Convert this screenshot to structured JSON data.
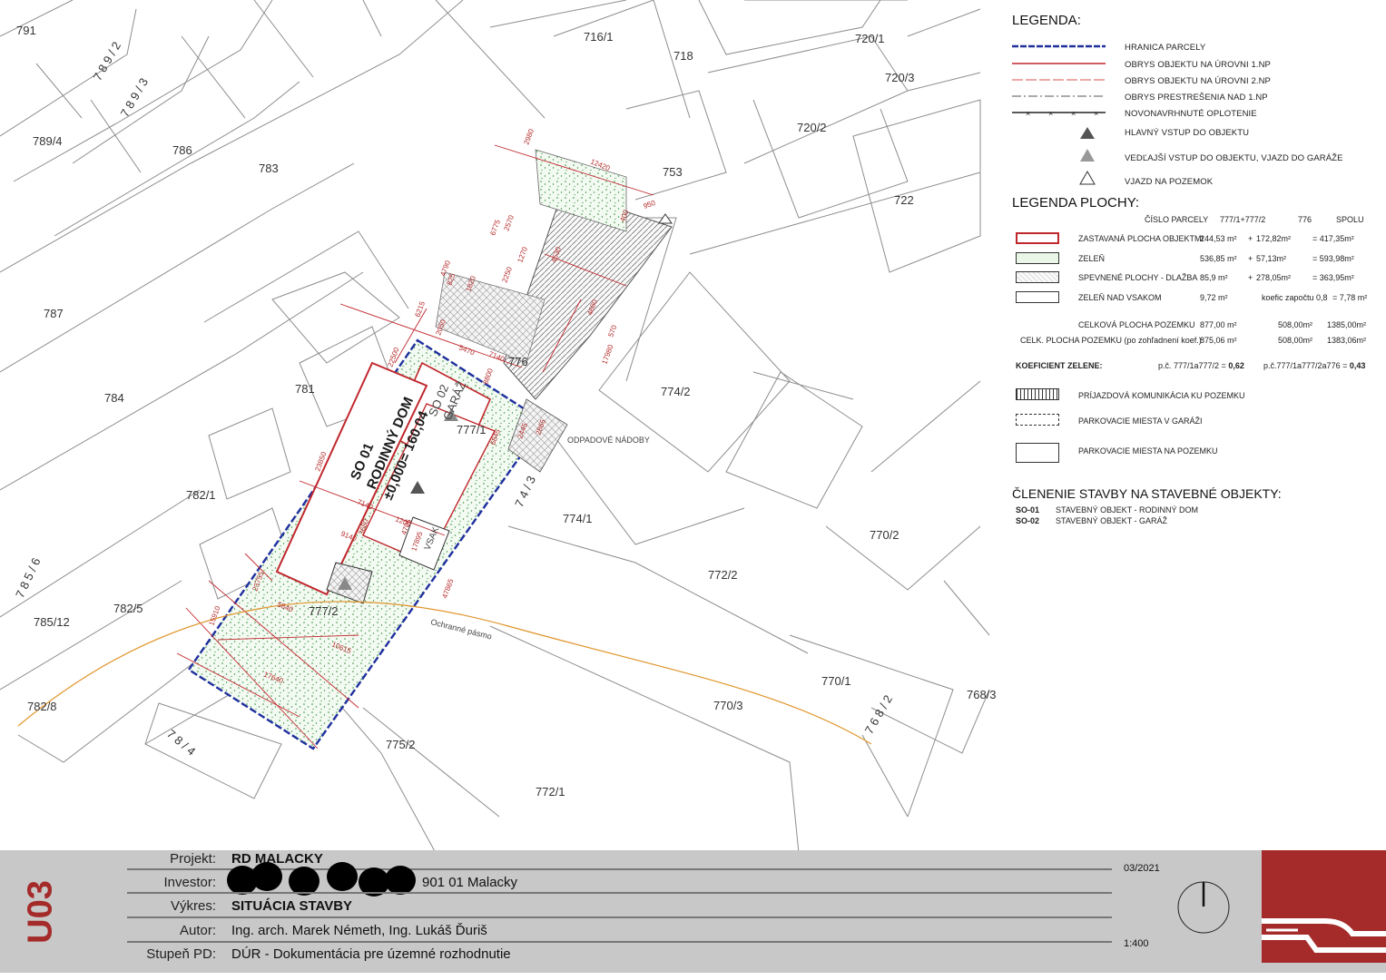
{
  "legend": {
    "title": "LEGENDA:",
    "items": [
      "HRANICA PARCELY",
      "OBRYS OBJEKTU NA ÚROVNI 1.NP",
      "OBRYS OBJEKTU NA ÚROVNI 2.NP",
      "OBRYS PRESTREŠENIA NAD 1.NP",
      "NOVONAVRHNUTÉ OPLOTENIE",
      "HLAVNÝ VSTUP DO OBJEKTU",
      "VEDĽAJŠÍ VSTUP DO OBJEKTU, VJAZD DO GARÁŽE",
      "VJAZD NA POZEMOK"
    ],
    "colors": {
      "parcel_boundary": "#1f2f9e",
      "outline_1np": "#c0272d",
      "outline_2np": "#d9534f",
      "canopy": "#555555",
      "fence": "#222222"
    }
  },
  "area_legend": {
    "title": "LEGENDA PLOCHY:",
    "header": {
      "col_label": "ČÍSLO PARCELY",
      "c1": "777/1+777/2",
      "c2": "776",
      "c3": "SPOLU"
    },
    "rows": [
      {
        "label": "ZASTAVANÁ PLOCHA OBJEKTMI",
        "v1": "244,53 m²",
        "op": "+",
        "v2": "172,82m²",
        "eq": "= 417,35m²"
      },
      {
        "label": "ZELEŇ",
        "v1": "536,85 m²",
        "op": "+",
        "v2": "57,13m²",
        "eq": "= 593,98m²"
      },
      {
        "label": "SPEVNENÉ PLOCHY - DLAŽBA",
        "v1": "85,9 m²",
        "op": "+",
        "v2": "278,05m²",
        "eq": "= 363,95m²"
      },
      {
        "label": "ZELEŇ NAD VSAKOM",
        "v1": "9,72 m²",
        "op": "",
        "v2": "koefic započtu 0,8",
        "eq": "= 7,78 m²"
      }
    ],
    "total1": {
      "label": "CELKOVÁ PLOCHA POZEMKU",
      "v1": "877,00 m²",
      "v2": "508,00m²",
      "v3": "1385,00m²"
    },
    "total2": {
      "label": "CELK. PLOCHA POZEMKU (po zohľadnení koef.)",
      "v1": "875,06 m²",
      "v2": "508,00m²",
      "v3": "1383,06m²"
    },
    "green_coef": {
      "label": "KOEFICIENT ZELENE:",
      "a_text": "p.č. 777/1a777/2 =",
      "a_val": "0,62",
      "b_text": "p.č.777/1a777/2a776 =",
      "b_val": "0,43"
    },
    "extra": [
      "PRÍJAZDOVÁ KOMUNIKÁCIA KU POZEMKU",
      "PARKOVACIE MIESTA V GARÁŽI",
      "PARKOVACIE MIESTA NA POZEMKU"
    ]
  },
  "objects": {
    "title": "ČLENENIE STAVBY NA STAVEBNÉ OBJEKTY:",
    "items": [
      {
        "code": "SO-01",
        "name": "STAVEBNÝ OBJEKT - RODINNÝ DOM"
      },
      {
        "code": "SO-02",
        "name": "STAVEBNÝ OBJEKT - GARÁŽ"
      }
    ]
  },
  "plan": {
    "parcels": [
      "791",
      "789/4",
      "786",
      "783",
      "787",
      "784",
      "782/1",
      "782/5",
      "785/12",
      "782/8",
      "716/1",
      "718",
      "720/1",
      "720/3",
      "720/2",
      "722",
      "753",
      "776",
      "774/2",
      "774/1",
      "772/2",
      "770/2",
      "770/1",
      "770/3",
      "768/3",
      "772/1",
      "775/2",
      "781",
      "777/1",
      "777/2"
    ],
    "parcel_vertical": [
      "7 8 9 / 2",
      "7 8 9 / 3",
      "7 8 5 / 6",
      "7 8 / 4",
      "7 4 / 3",
      "7 6 8 / 2"
    ],
    "building_so01": [
      "SO 01",
      "RODINNÝ DOM",
      "±0,000= 160,04"
    ],
    "building_so02": [
      "SO 02",
      "GARÁŽ"
    ],
    "labels": {
      "waste": "ODPADOVÉ NÁDOBY",
      "soak": "VSAK",
      "zone": "Ochranné pásmo"
    },
    "dims": [
      "12420",
      "2980",
      "950",
      "400",
      "6775",
      "2570",
      "1270",
      "4530",
      "4790",
      "825",
      "2250",
      "1820",
      "6215",
      "2050",
      "4680",
      "570",
      "5470",
      "7140",
      "17980",
      "22500",
      "8800",
      "6845",
      "2445",
      "2865",
      "23850",
      "7140",
      "9140",
      "3680",
      "1200",
      "4705",
      "17895",
      "15910",
      "10615",
      "23755",
      "5840",
      "47865",
      "17640"
    ]
  },
  "title_block": {
    "code": "U03",
    "rows": [
      {
        "label": "Projekt:",
        "value": "RD MALACKY"
      },
      {
        "label": "Investor:",
        "value": "901 01 Malacky"
      },
      {
        "label": "Výkres:",
        "value": "SITUÁCIA STAVBY"
      },
      {
        "label": "Autor:",
        "value": "Ing. arch. Marek Németh, Ing. Lukáš Ďuriš"
      },
      {
        "label": "Stupeň PD:",
        "value": "DÚR - Dokumentácia pre územné rozhodnutie"
      }
    ],
    "date": "03/2021",
    "scale": "1:400",
    "accent": "#a52a2a"
  }
}
